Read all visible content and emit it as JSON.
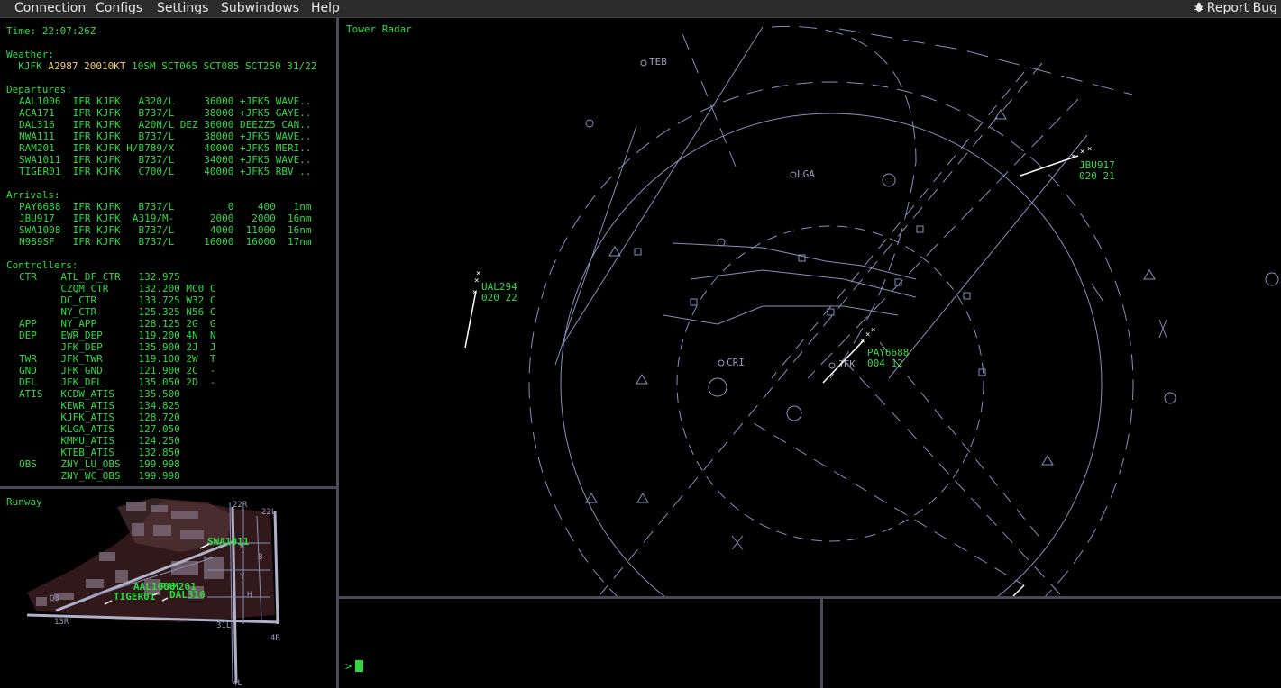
{
  "menu": {
    "items": [
      "Connection",
      "Configs",
      "Settings",
      "Subwindows",
      "Help"
    ],
    "report_bug": "Report Bug"
  },
  "info": {
    "time": "Time: 22:07:26Z",
    "weather_header": "Weather:",
    "weather_station": "KJFK",
    "weather_altimeter": "A2987",
    "weather_wind": "20010KT",
    "weather_rest": "10SM SCT065 SCT085 SCT250 31/22",
    "departures_header": "Departures:",
    "departures": [
      "AAL1006  IFR KJFK   A320/L     36000 +JFK5 WAVE..",
      "ACA171   IFR KJFK   B737/L     38000 +JFK5 GAYE..",
      "DAL316   IFR KJFK   A20N/L DEZ 36000 DEEZZ5 CAN..",
      "NWA111   IFR KJFK   B737/L     38000 +JFK5 WAVE..",
      "RAM201   IFR KJFK H/B789/X     40000 +JFK5 MERI..",
      "SWA1011  IFR KJFK   B737/L     34000 +JFK5 WAVE..",
      "TIGER01  IFR KJFK   C700/L     40000 +JFK5 RBV .."
    ],
    "arrivals_header": "Arrivals:",
    "arrivals": [
      "PAY6688  IFR KJFK   B737/L         0    400   1nm",
      "JBU917   IFR KJFK  A319/M-      2000   2000  16nm",
      "SWA1008  IFR KJFK   B737/L      4000  11000  16nm",
      "N989SF   IFR KJFK   B737/L     16000  16000  17nm"
    ],
    "controllers_header": "Controllers:",
    "controllers": [
      "CTR    ATL_DF_CTR   132.975",
      "       CZQM_CTR     132.200 MC0 C",
      "       DC_CTR       133.725 W32 C",
      "       NY_CTR       125.325 N56 C",
      "APP    NY_APP       128.125 2G  G",
      "DEP    EWR_DEP      119.200 4N  N",
      "       JFK_DEP      135.900 2J  J",
      "TWR    JFK_TWR      119.100 2W  T",
      "GND    JFK_GND      121.900 2C  -",
      "DEL    JFK_DEL      135.050 2D  -",
      "ATIS   KCDW_ATIS    135.500",
      "       KEWR_ATIS    134.825",
      "       KJFK_ATIS    128.720",
      "       KLGA_ATIS    127.050",
      "       KMMU_ATIS    124.250",
      "       KTEB_ATIS    132.850",
      "OBS    ZNY_LU_OBS   199.998",
      "       ZNY_WC_OBS   199.998"
    ]
  },
  "runway": {
    "title": "Runway",
    "labels": [
      "SWA1011",
      "AAL1006",
      "RAM201",
      "TIGER01",
      "DAL316"
    ],
    "taxi_labels": [
      "22R",
      "22L",
      "K",
      "B",
      "Y",
      "H",
      "4R",
      "4L",
      "13R",
      "31L",
      "Q3"
    ]
  },
  "radar": {
    "title": "Tower Radar",
    "fixes": [
      "TEB",
      "LGA",
      "CRI",
      "JFK"
    ],
    "aircraft": [
      {
        "callsign": "UAL294",
        "data": "020 22"
      },
      {
        "callsign": "JBU917",
        "data": "020 21"
      },
      {
        "callsign": "PAY6688",
        "data": "004 12"
      }
    ]
  },
  "console": {
    "prompt": ">"
  },
  "colors": {
    "text_green": "#31d843",
    "weather_yellow": "#f0d060",
    "map_lines": "#8a8fb8",
    "panel_border": "#4a4a5a"
  }
}
